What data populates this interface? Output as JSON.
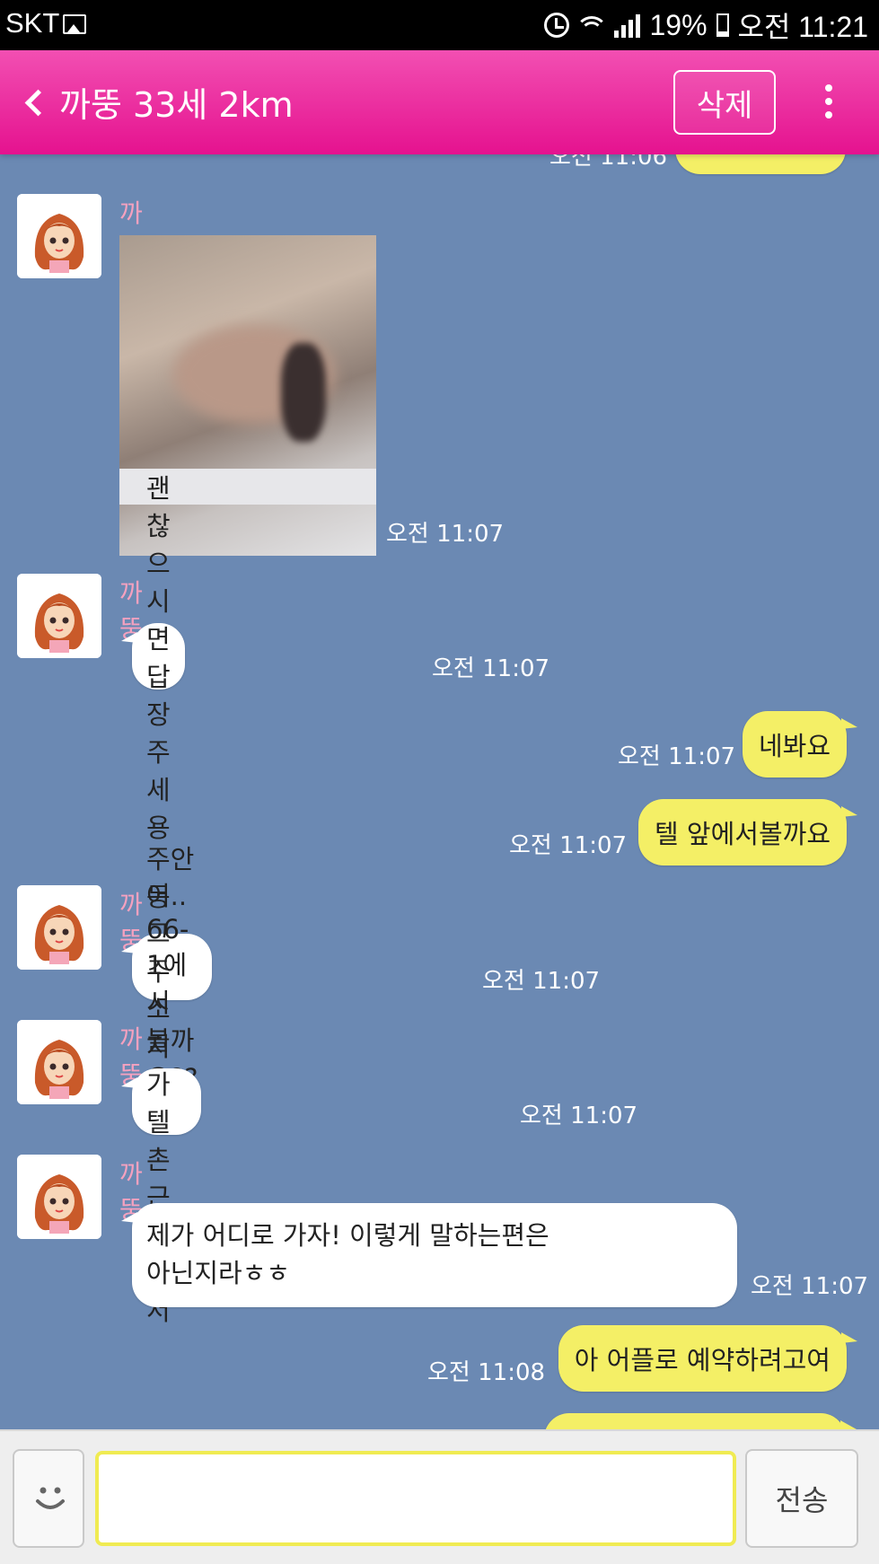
{
  "status_bar": {
    "carrier": "SKT",
    "battery": "19%",
    "time": "오전 11:21"
  },
  "header": {
    "title": "까뚱 33세 2km",
    "delete_label": "삭제"
  },
  "partner_name": "까뚱",
  "messages": [
    {
      "side": "left",
      "name": "까뚱",
      "type": "image",
      "time": "오전 11:07"
    },
    {
      "side": "left",
      "name": "까뚱",
      "text": "괜찮으시면 답장주세용",
      "time": "오전 11:07"
    },
    {
      "side": "right",
      "text": "네봐요",
      "time": "오전 11:07"
    },
    {
      "side": "right",
      "text": "텔 앞에서볼까요",
      "time": "오전 11:07"
    },
    {
      "side": "left",
      "name": "까뚱",
      "text": "주안동 66-1에서 볼까요??",
      "time": "오전 11:07"
    },
    {
      "side": "left",
      "name": "까뚱",
      "text": "어.. 그 주소지가 텔촌 근처라서",
      "time": "오전 11:07"
    },
    {
      "side": "left",
      "name": "까뚱",
      "text_line1": "제가 어디로 가자! 이렇게 말하는편은",
      "text_line2": "아닌지라ㅎㅎ",
      "time": "오전 11:07"
    },
    {
      "side": "right",
      "text": "아 어플로 예약하려고여",
      "time": "오전 11:08"
    }
  ],
  "input": {
    "value": "",
    "send_label": "전송"
  },
  "colors": {
    "header": "#e5128f",
    "chat_bg": "#6b89b3",
    "my_bubble": "#f4ef66",
    "name": "#f5a1bf"
  }
}
